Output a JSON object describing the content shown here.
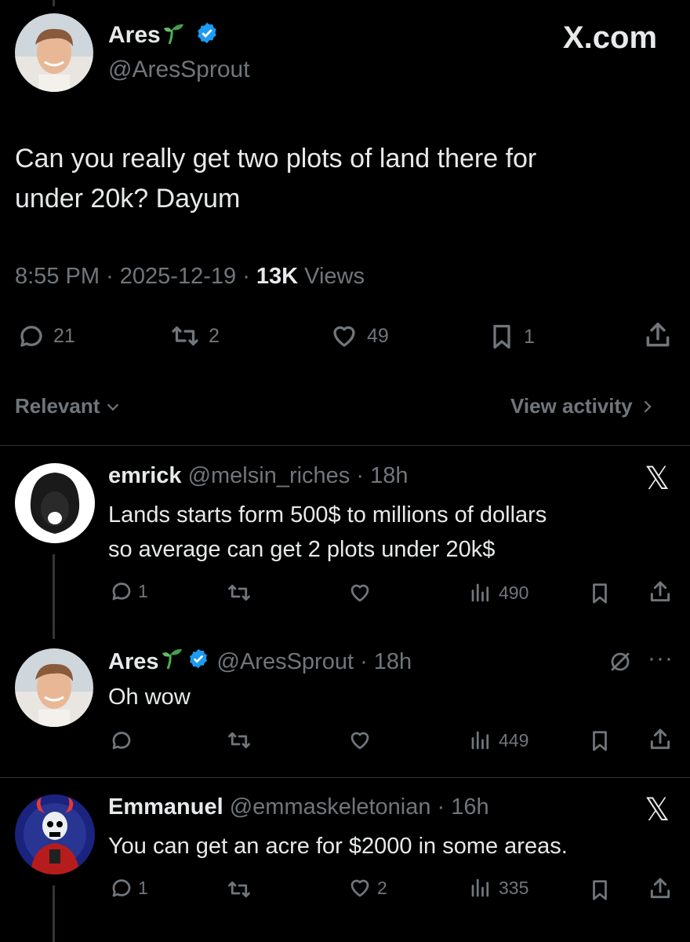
{
  "header": {
    "site": "X.com"
  },
  "main_tweet": {
    "name": "Ares",
    "handle": "@AresSprout",
    "text_line1": "Can you really get two plots of land there for",
    "text_line2": "under 20k? Dayum",
    "time": "8:55 PM",
    "date": "2025-12-19",
    "views_count": "13K",
    "views_label": "Views",
    "replies": "21",
    "reposts": "2",
    "likes": "49",
    "bookmarks": "1"
  },
  "sort": {
    "label": "Relevant",
    "view_activity": "View activity"
  },
  "replies": [
    {
      "name": "emrick",
      "handle": "@melsin_riches",
      "age": "18h",
      "line1": "Lands starts form 500$ to millions of dollars",
      "line2": "so average can get 2 plots under 20k$",
      "replies": "1",
      "views": "490"
    },
    {
      "name": "Ares",
      "handle": "@AresSprout",
      "age": "18h",
      "line1": "Oh wow",
      "views": "449"
    },
    {
      "name": "Emmanuel",
      "handle": "@emmaskeletonian",
      "age": "16h",
      "line1": "You can get an acre for $2000 in some areas.",
      "replies": "1",
      "likes": "2",
      "views": "335"
    }
  ],
  "colors": {
    "background": "#000000",
    "text": "#e7e9ea",
    "muted": "#71767b",
    "verified": "#1d9bf0",
    "divider": "#2f3336"
  }
}
